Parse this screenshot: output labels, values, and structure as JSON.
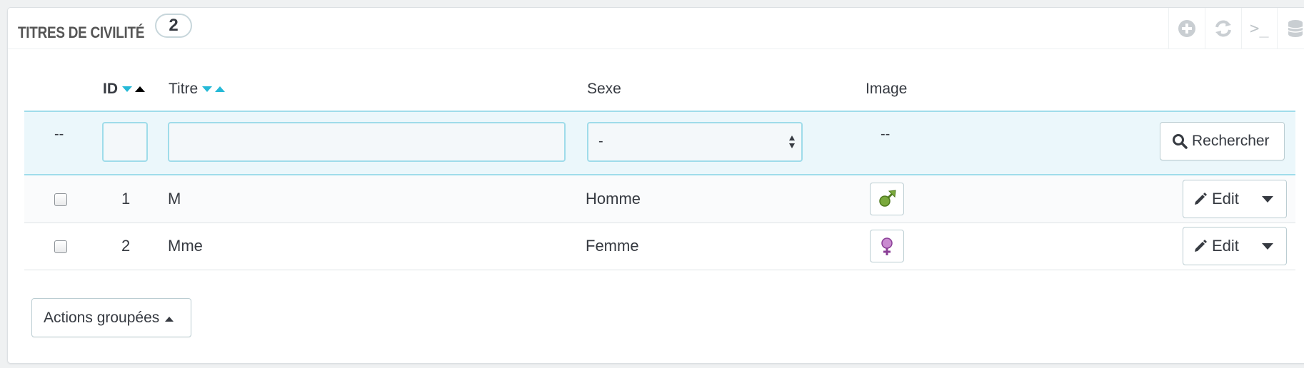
{
  "panel": {
    "title": "TITRES DE CIVILITÉ",
    "count": "2",
    "toolbar_icons": [
      "add-icon",
      "refresh-icon",
      "terminal-icon",
      "database-icon"
    ],
    "terminal_glyph": ">_"
  },
  "table": {
    "headers": {
      "id": "ID",
      "titre": "Titre",
      "sexe": "Sexe",
      "image": "Image"
    },
    "filters": {
      "checkbox_placeholder": "--",
      "id_value": "",
      "titre_value": "",
      "sexe_selected": "-",
      "image_placeholder": "--",
      "search_label": "Rechercher"
    },
    "rows": [
      {
        "id": "1",
        "titre": "M",
        "sexe": "Homme",
        "image_icon": "male-symbol-icon",
        "action": "Edit"
      },
      {
        "id": "2",
        "titre": "Mme",
        "sexe": "Femme",
        "image_icon": "female-symbol-icon",
        "action": "Edit"
      }
    ]
  },
  "footer": {
    "bulk_actions_label": "Actions groupées"
  },
  "colors": {
    "accent": "#25b9d7",
    "filter_bg": "#ebf7fb",
    "border": "#bbcdd2",
    "male_icon": "#6a9a32",
    "female_icon": "#b366b3"
  }
}
